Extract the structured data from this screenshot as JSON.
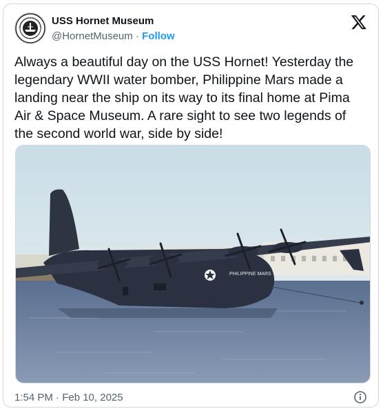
{
  "tweet": {
    "author_name": "USS Hornet Museum",
    "handle": "@HornetMuseum",
    "separator": "·",
    "follow_label": "Follow",
    "text": "Always a beautiful day on the USS Hornet! Yesterday the legendary WWII water bomber, Philippine Mars made a landing near the ship on its way to its final home at Pima Air & Space Museum. A rare sight to see two legends of the second world war, side by side!",
    "timestamp": "1:54 PM · Feb 10, 2025"
  },
  "media": {
    "aircraft_label": "PHILIPPINE MARS"
  },
  "icons": {
    "platform": "x-logo-icon",
    "info": "info-icon"
  },
  "colors": {
    "accent": "#1d9bf0",
    "text_primary": "#0f1419",
    "text_secondary": "#536471",
    "border": "#cfd9de"
  }
}
